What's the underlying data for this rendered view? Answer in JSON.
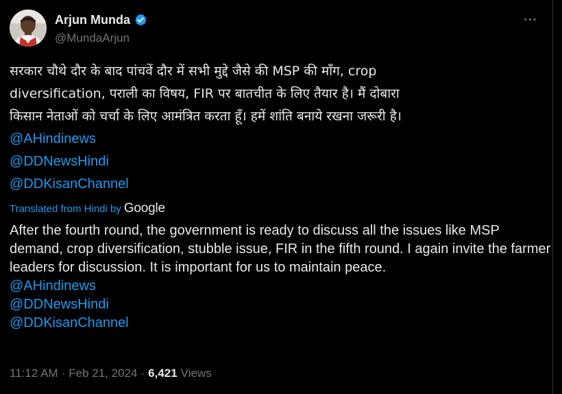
{
  "author": {
    "display_name": "Arjun Munda",
    "handle": "@MundaArjun"
  },
  "menu": {
    "more": "···"
  },
  "tweet": {
    "hindi_text": "सरकार चौथे दौर के बाद पांचवें दौर में सभी मुद्दे जैसे की MSP की माँग, crop diversification, पराली का विषय, FIR पर बातचीत के लिए तैयार है। मैं दोबारा किसान नेताओं को चर्चा के लिए आमंत्रित करता हूँ। हमें शांति बनाये रखना जरूरी है।",
    "mentions": [
      "@AHindinews",
      "@DDNewsHindi",
      "@DDKisanChannel"
    ],
    "translated_label": "Translated from Hindi by",
    "translator_brand": "Google",
    "english_text": "After the fourth round, the government is ready to discuss all the issues like MSP demand, crop diversification, stubble issue, FIR in the fifth round. I again invite the farmer leaders for discussion. It is important for us to maintain peace.",
    "english_mentions": [
      "@AHindinews",
      "@DDNewsHindi",
      "@DDKisanChannel"
    ]
  },
  "meta": {
    "time": "11:12 AM",
    "separator": "·",
    "date": "Feb 21, 2024",
    "views_count": "6,421",
    "views_label": "Views"
  },
  "colors": {
    "background": "#000000",
    "text": "#e7e9ea",
    "muted": "#71767b",
    "link": "#1d9bf0",
    "verified": "#1d9bf0"
  },
  "icons": {
    "verified": "verified-badge-icon",
    "more": "more-dots-icon"
  }
}
